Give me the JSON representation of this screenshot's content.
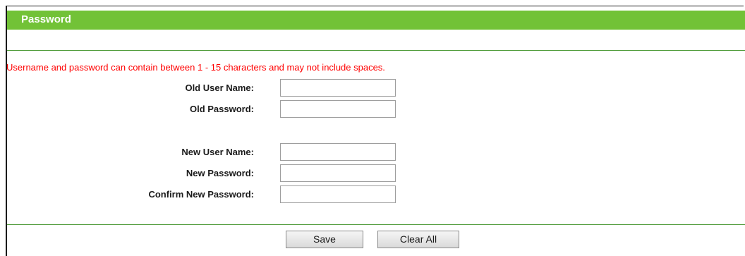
{
  "header": {
    "title": "Password"
  },
  "notice": "Username and password can contain between 1 - 15 characters and may not include spaces.",
  "form": {
    "old_user_name": {
      "label": "Old User Name:",
      "value": ""
    },
    "old_password": {
      "label": "Old Password:",
      "value": ""
    },
    "new_user_name": {
      "label": "New User Name:",
      "value": ""
    },
    "new_password": {
      "label": "New Password:",
      "value": ""
    },
    "confirm_new_password": {
      "label": "Confirm New Password:",
      "value": ""
    }
  },
  "buttons": {
    "save": "Save",
    "clear_all": "Clear All"
  },
  "colors": {
    "header_bg": "#72c237",
    "notice_text": "#ff0000",
    "divider": "#4f9b3a"
  }
}
